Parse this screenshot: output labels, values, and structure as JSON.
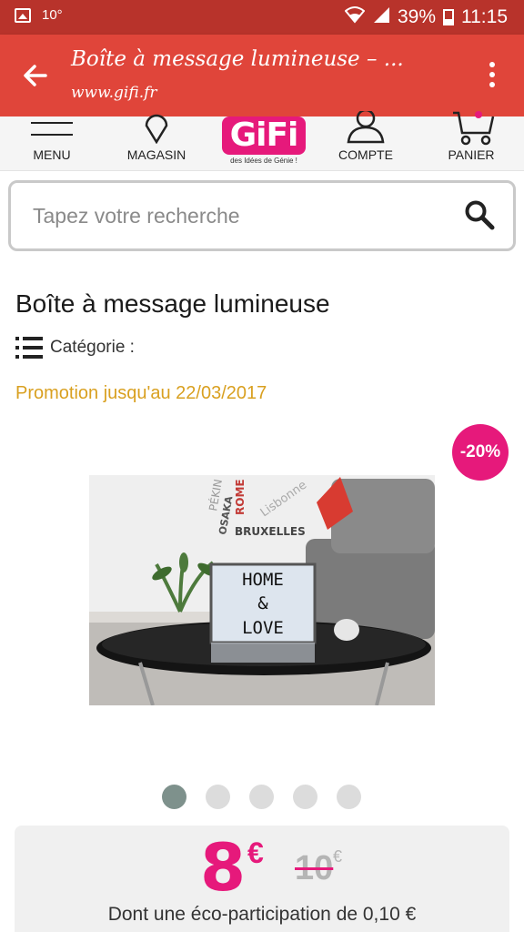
{
  "status_bar": {
    "temperature": "10°",
    "battery": "39%",
    "time": "11:15"
  },
  "browser": {
    "title": "Boîte à message lumineuse – ...",
    "url": "www.gifi.fr"
  },
  "nav": {
    "menu": "MENU",
    "store": "MAGASIN",
    "logo_text": "GiFi",
    "logo_tagline": "des Idées de Génie !",
    "account": "COMPTE",
    "cart": "PANIER"
  },
  "search": {
    "placeholder": "Tapez votre recherche"
  },
  "product": {
    "title": "Boîte à message lumineuse",
    "category_label": "Catégorie :",
    "promo": "Promotion jusqu'au 22/03/2017",
    "discount_badge": "-20%",
    "lightbox_lines": [
      "HOME",
      "&",
      "LOVE"
    ],
    "poster_words": [
      "PÉKIN",
      "OSAKA",
      "ROME",
      "Lisbonne",
      "BRUXELLES"
    ],
    "carousel": {
      "count": 5,
      "active": 1
    }
  },
  "price": {
    "current": "8",
    "current_currency": "€",
    "old": "10",
    "old_currency": "€",
    "eco_participation": "Dont une éco-participation de 0,10 €"
  },
  "colors": {
    "status_bar": "#b8332b",
    "app_bar": "#e0453a",
    "brand_pink": "#e6197b",
    "promo": "#d9a020",
    "dot_active": "#7e918c"
  }
}
